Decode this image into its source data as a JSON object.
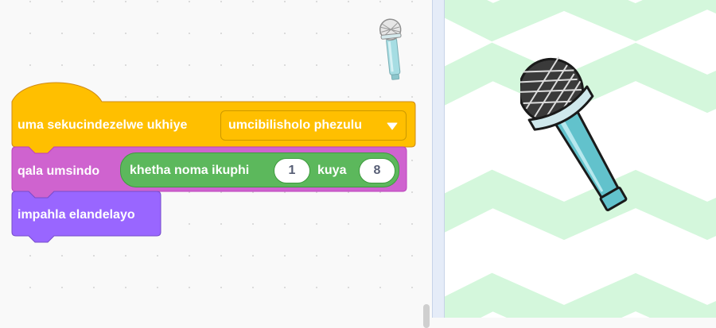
{
  "colors": {
    "events_block": "#ffbf00",
    "sound_block": "#cf63cf",
    "operator_block": "#59c059",
    "looks_block": "#9966ff",
    "backdrop_chevron": "#d4f7dc"
  },
  "workspace": {
    "sprite_thumbnail_icon": "microphone-icon",
    "blocks": {
      "hat": {
        "label": "uma sekucindezelwe ukhiye",
        "dropdown_value": "umcibilisholo phezulu",
        "dropdown_icon": "triangle-down-icon"
      },
      "start_sound": {
        "label": "qala umsindo",
        "pick_random": {
          "label": "khetha noma ikuphi",
          "from": "1",
          "to_label": "kuya",
          "to": "8"
        }
      },
      "next_costume": {
        "label": "impahla elandelayo"
      }
    }
  },
  "stage": {
    "sprite_icon": "microphone-icon",
    "backdrop": "green-chevron-pattern"
  }
}
